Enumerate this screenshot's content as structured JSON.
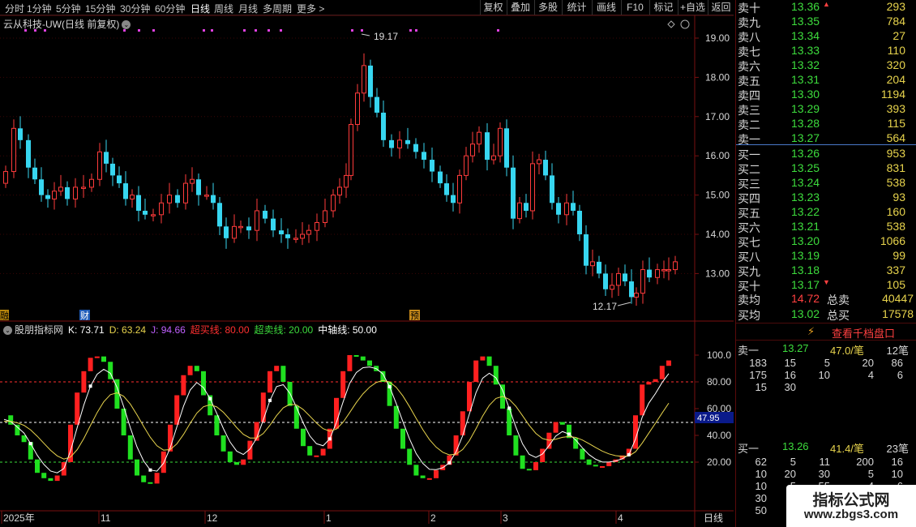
{
  "toolbar": {
    "periods": [
      "分时",
      "1分钟",
      "5分钟",
      "15分钟",
      "30分钟",
      "60分钟",
      "日线",
      "周线",
      "月线",
      "多周期",
      "更多 >"
    ],
    "active_period": "日线",
    "buttons": [
      "复权",
      "叠加",
      "多股",
      "统计",
      "画线",
      "F10",
      "标记",
      "+自选",
      "返回"
    ]
  },
  "main_chart": {
    "title": "云从科技-UW(日线 前复权)",
    "y_ticks": [
      "19.00",
      "18.00",
      "17.00",
      "16.00",
      "15.00",
      "14.00",
      "13.00"
    ],
    "high_label": "19.17",
    "low_label": "12.17",
    "event_markers": [
      "融",
      "财",
      "预"
    ]
  },
  "indicator": {
    "name": "股朋指标网",
    "k": "K: 73.71",
    "d": "D: 63.24",
    "j": "J: 94.66",
    "overbought": "超买线: 80.00",
    "oversold": "超卖线: 20.00",
    "middle": "中轴线: 50.00",
    "y_ticks": [
      "100.0",
      "80.00",
      "60.00",
      "40.00",
      "20.00"
    ],
    "current_value": "47.95",
    "colors": {
      "k": "#ffffff",
      "d": "#e8d44d",
      "j": "#c060ff",
      "overbought": "#ff3030",
      "oversold": "#3ddc3d",
      "middle": "#ffffff"
    }
  },
  "x_axis": {
    "labels": [
      "2025年",
      "11",
      "12",
      "1",
      "2",
      "3",
      "4"
    ],
    "period_label": "日线"
  },
  "order_book": {
    "asks": [
      {
        "label": "卖十",
        "price": "13.36",
        "vol": "293",
        "arrow": "up"
      },
      {
        "label": "卖九",
        "price": "13.35",
        "vol": "784"
      },
      {
        "label": "卖八",
        "price": "13.34",
        "vol": "27"
      },
      {
        "label": "卖七",
        "price": "13.33",
        "vol": "110"
      },
      {
        "label": "卖六",
        "price": "13.32",
        "vol": "320"
      },
      {
        "label": "卖五",
        "price": "13.31",
        "vol": "204"
      },
      {
        "label": "卖四",
        "price": "13.30",
        "vol": "1194"
      },
      {
        "label": "卖三",
        "price": "13.29",
        "vol": "393"
      },
      {
        "label": "卖二",
        "price": "13.28",
        "vol": "115"
      },
      {
        "label": "卖一",
        "price": "13.27",
        "vol": "564"
      }
    ],
    "bids": [
      {
        "label": "买一",
        "price": "13.26",
        "vol": "953"
      },
      {
        "label": "买二",
        "price": "13.25",
        "vol": "831"
      },
      {
        "label": "买三",
        "price": "13.24",
        "vol": "538"
      },
      {
        "label": "买四",
        "price": "13.23",
        "vol": "93"
      },
      {
        "label": "买五",
        "price": "13.22",
        "vol": "160"
      },
      {
        "label": "买六",
        "price": "13.21",
        "vol": "538"
      },
      {
        "label": "买七",
        "price": "13.20",
        "vol": "1066"
      },
      {
        "label": "买八",
        "price": "13.19",
        "vol": "99"
      },
      {
        "label": "买九",
        "price": "13.18",
        "vol": "337"
      },
      {
        "label": "买十",
        "price": "13.17",
        "vol": "105",
        "arrow": "down"
      }
    ],
    "avg_sell_label": "卖均",
    "avg_sell": "14.72",
    "total_sell_label": "总卖",
    "total_sell": "40447",
    "avg_buy_label": "买均",
    "avg_buy": "13.02",
    "total_buy_label": "总买",
    "total_buy": "17578"
  },
  "thousand_queue": {
    "button": "查看千档盘口",
    "ask1_label": "卖一",
    "ask1_price": "13.27",
    "ask1_avg": "47.0/笔",
    "ask1_count": "12笔",
    "ask1_rows": [
      [
        "183",
        "15",
        "5",
        "20",
        "86"
      ],
      [
        "175",
        "16",
        "10",
        "4",
        "6"
      ],
      [
        "15",
        "30"
      ]
    ],
    "bid1_label": "买一",
    "bid1_price": "13.26",
    "bid1_avg": "41.4/笔",
    "bid1_count": "23笔",
    "bid1_rows": [
      [
        "62",
        "5",
        "11",
        "200",
        "16"
      ],
      [
        "10",
        "20",
        "30",
        "5",
        "10"
      ],
      [
        "10",
        "5",
        "55",
        "4",
        "6"
      ],
      [
        "30",
        "",
        "",
        "",
        ""
      ],
      [
        "50",
        "2",
        "",
        "",
        ""
      ]
    ]
  },
  "watermark": {
    "line1": "指标公式网",
    "line2": "www.zbgs3.com"
  }
}
